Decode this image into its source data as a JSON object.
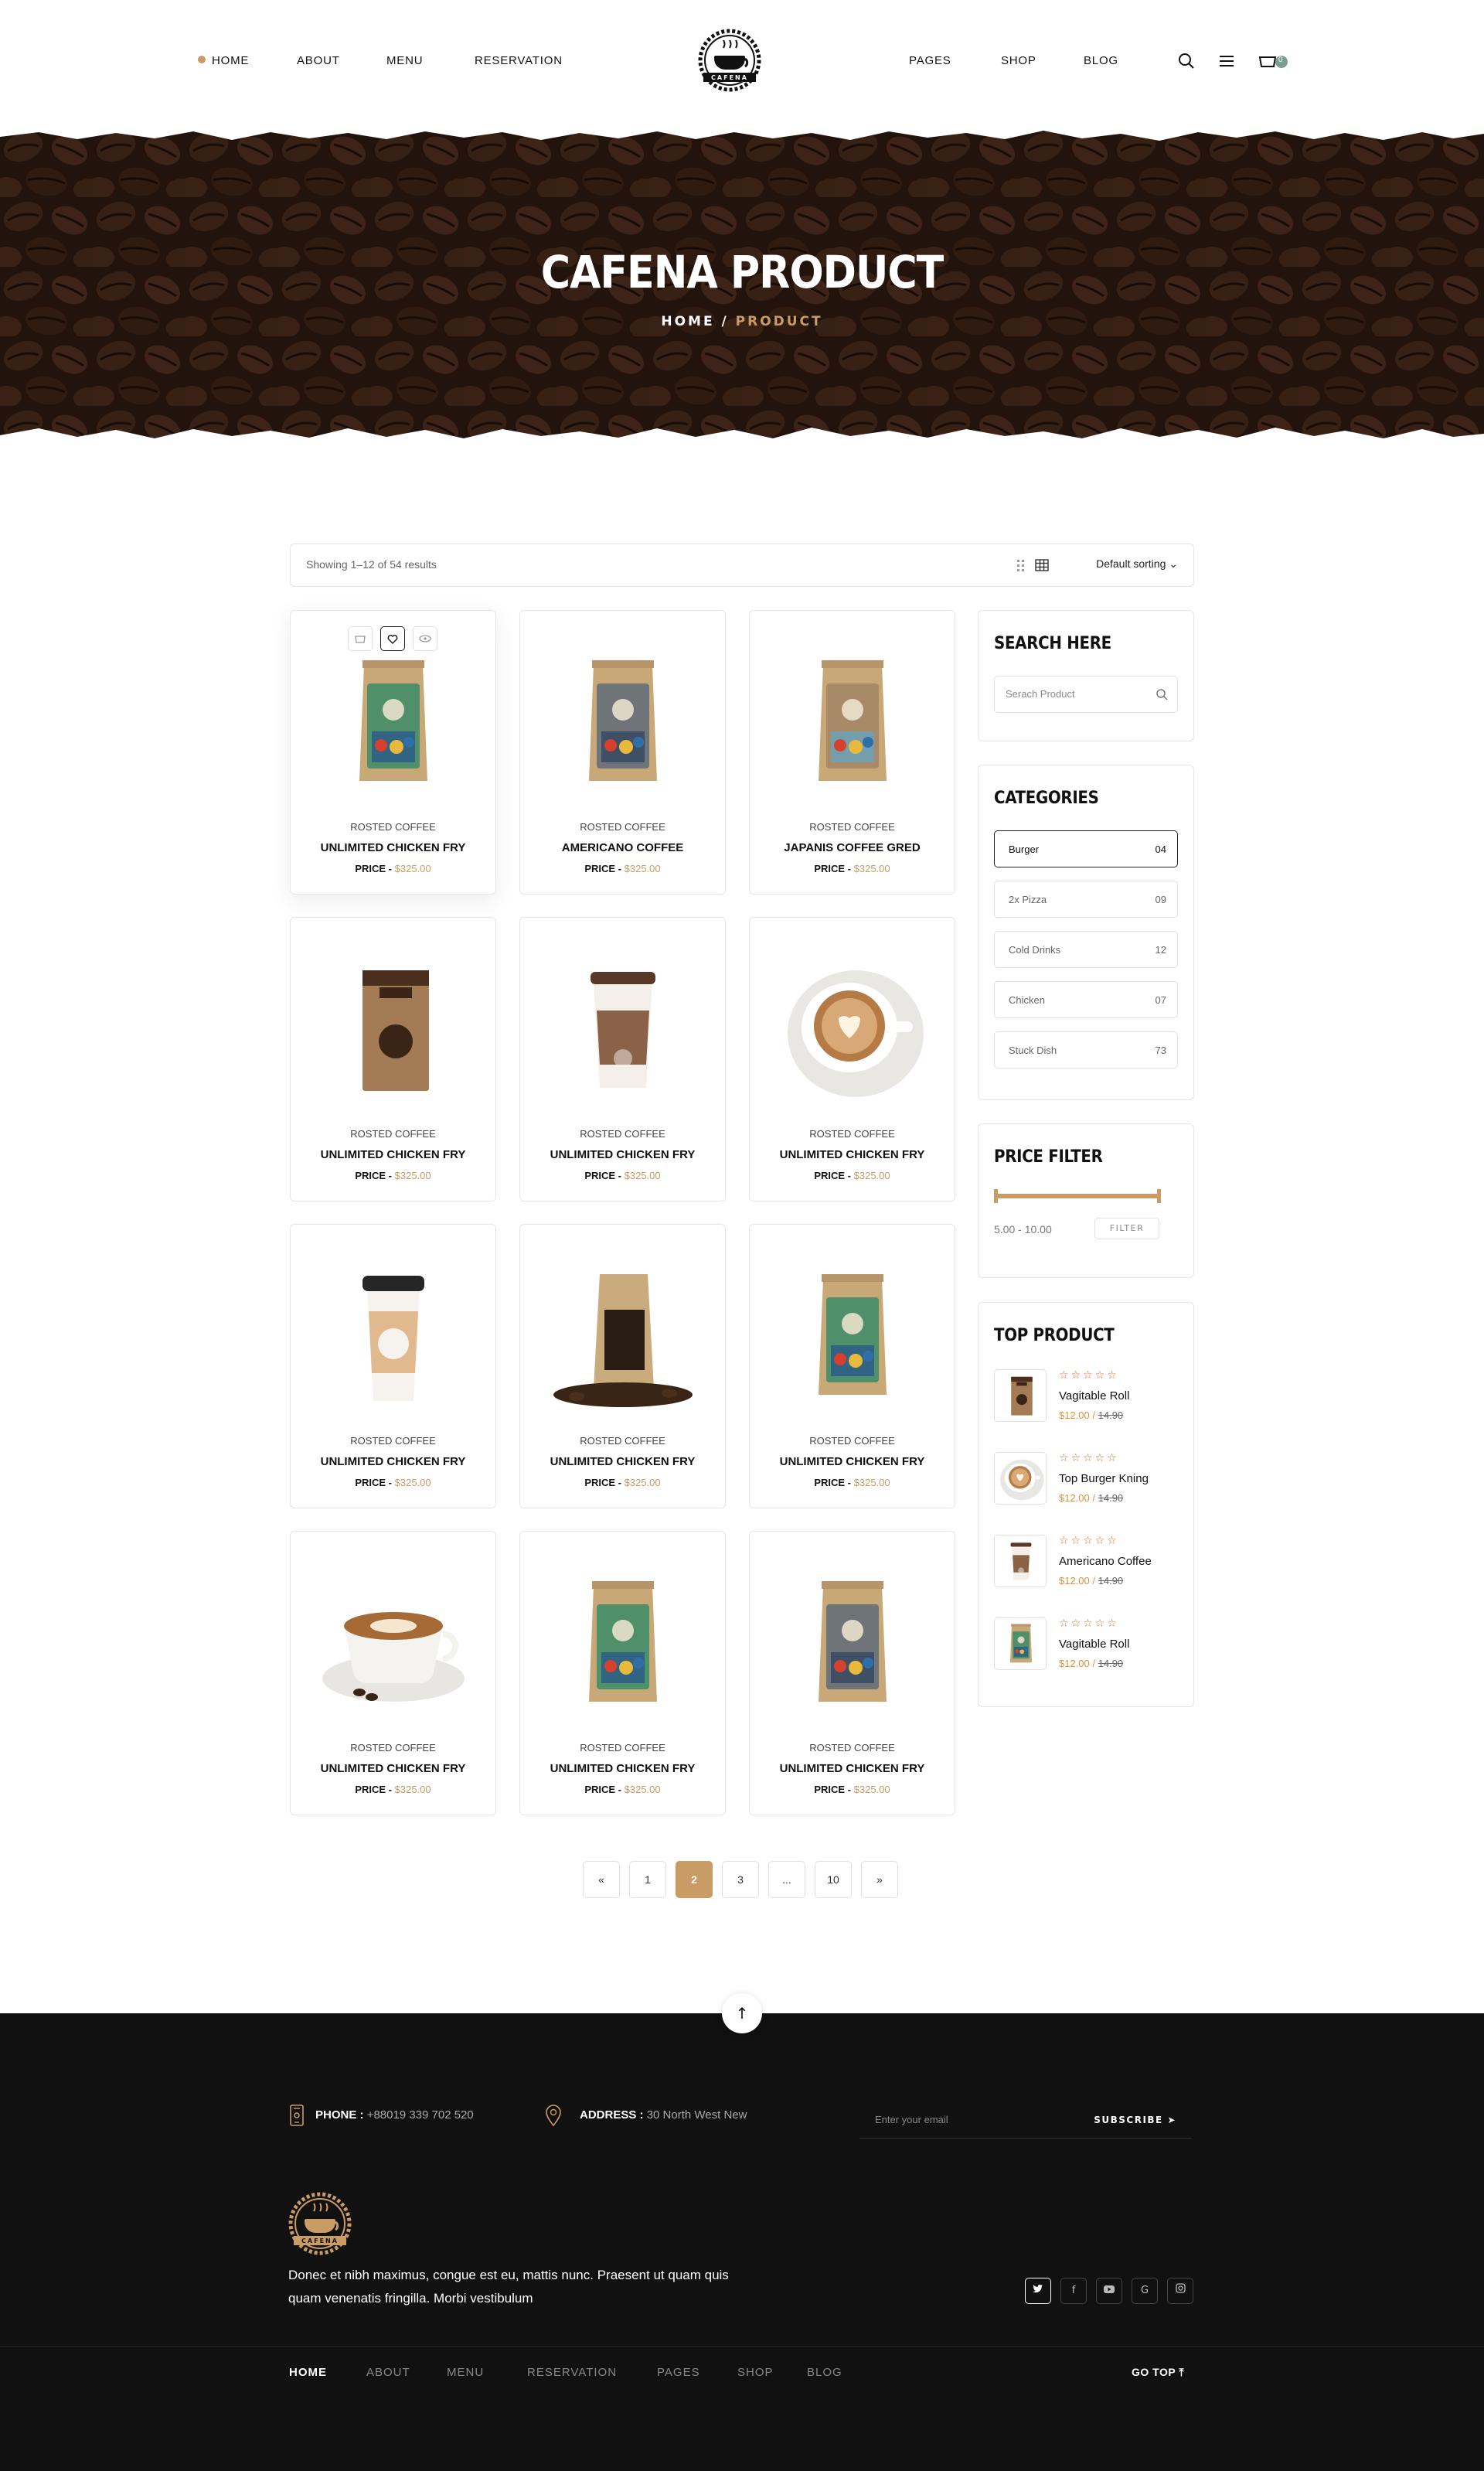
{
  "header": {
    "nav_left": [
      "HOME",
      "ABOUT",
      "MENU",
      "RESERVATION"
    ],
    "nav_right": [
      "PAGES",
      "SHOP",
      "BLOG"
    ],
    "logo_text": "CAFENA",
    "cart_count": "0",
    "icons": [
      "search-icon",
      "menu-icon",
      "cart-icon"
    ]
  },
  "hero": {
    "title": "CAFENA PRODUCT",
    "crumb_home": "HOME",
    "crumb_sep": "/",
    "crumb_active": "PRODUCT"
  },
  "toolbar": {
    "results": "Showing 1–12 of 54 results",
    "sort": "Default sorting"
  },
  "products": [
    {
      "category": "ROSTED COFFEE",
      "name": "UNLIMITED CHICKEN FRY",
      "price_label": "PRICE -",
      "price": "$325.00",
      "image": "green-bag"
    },
    {
      "category": "ROSTED COFFEE",
      "name": "AMERICANO COFFEE",
      "price_label": "PRICE -",
      "price": "$325.00",
      "image": "grey-bag"
    },
    {
      "category": "ROSTED COFFEE",
      "name": "JAPANIS COFFEE GRED",
      "price_label": "PRICE -",
      "price": "$325.00",
      "image": "peru-bag"
    },
    {
      "category": "ROSTED COFFEE",
      "name": "UNLIMITED CHICKEN FRY",
      "price_label": "PRICE -",
      "price": "$325.00",
      "image": "kraft-bag"
    },
    {
      "category": "ROSTED COFFEE",
      "name": "UNLIMITED CHICKEN FRY",
      "price_label": "PRICE -",
      "price": "$325.00",
      "image": "paper-cup"
    },
    {
      "category": "ROSTED COFFEE",
      "name": "UNLIMITED CHICKEN FRY",
      "price_label": "PRICE -",
      "price": "$325.00",
      "image": "latte-top"
    },
    {
      "category": "ROSTED COFFEE",
      "name": "UNLIMITED CHICKEN FRY",
      "price_label": "PRICE -",
      "price": "$325.00",
      "image": "togo-cup"
    },
    {
      "category": "ROSTED COFFEE",
      "name": "UNLIMITED CHICKEN FRY",
      "price_label": "PRICE -",
      "price": "$325.00",
      "image": "beans-bag"
    },
    {
      "category": "ROSTED COFFEE",
      "name": "UNLIMITED CHICKEN FRY",
      "price_label": "PRICE -",
      "price": "$325.00",
      "image": "green-bag"
    },
    {
      "category": "ROSTED COFFEE",
      "name": "UNLIMITED CHICKEN FRY",
      "price_label": "PRICE -",
      "price": "$325.00",
      "image": "latte-cup"
    },
    {
      "category": "ROSTED COFFEE",
      "name": "UNLIMITED CHICKEN FRY",
      "price_label": "PRICE -",
      "price": "$325.00",
      "image": "green-bag"
    },
    {
      "category": "ROSTED COFFEE",
      "name": "UNLIMITED CHICKEN FRY",
      "price_label": "PRICE -",
      "price": "$325.00",
      "image": "grey-bag"
    }
  ],
  "sidebar": {
    "search_title": "SEARCH HERE",
    "search_placeholder": "Serach Product",
    "categories_title": "CATEGORIES",
    "categories": [
      {
        "label": "Burger",
        "count": "04"
      },
      {
        "label": "2x Pizza",
        "count": "09"
      },
      {
        "label": "Cold Drinks",
        "count": "12"
      },
      {
        "label": "Chicken",
        "count": "07"
      },
      {
        "label": "Stuck Dish",
        "count": "73"
      }
    ],
    "price_title": "PRICE FILTER",
    "price_range": "5.00 - 10.00",
    "filter_label": "FILTER",
    "top_title": "TOP PRODUCT",
    "top_products": [
      {
        "stars": "☆☆☆☆☆",
        "name": "Vagitable Roll",
        "price": "$12.00 /",
        "old": "14.90",
        "image": "kraft-bag"
      },
      {
        "stars": "☆☆☆☆☆",
        "name": "Top Burger Kning",
        "price": "$12.00 /",
        "old": "14.90",
        "image": "latte-top"
      },
      {
        "stars": "☆☆☆☆☆",
        "name": "Americano Coffee",
        "price": "$12.00 /",
        "old": "14.90",
        "image": "paper-cup"
      },
      {
        "stars": "☆☆☆☆☆",
        "name": "Vagitable Roll",
        "price": "$12.00 /",
        "old": "14.90",
        "image": "green-bag"
      }
    ]
  },
  "pagination": [
    "«",
    "1",
    "2",
    "3",
    "...",
    "10",
    "»"
  ],
  "pagination_active": "2",
  "footer": {
    "to_top": "↑",
    "phone_label": "PHONE :",
    "phone": "+88019 339 702 520",
    "address_label": "ADDRESS :",
    "address": "30 North West New",
    "email_placeholder": "Enter your email",
    "subscribe": "SUBSCRIBE",
    "logo_text": "CAFENA",
    "text": "Donec et nibh maximus, congue est eu, mattis nunc. Praesent ut quam quis quam venenatis fringilla. Morbi vestibulum",
    "social": [
      "twitter-icon",
      "facebook-icon",
      "youtube-icon",
      "google-icon",
      "instagram-icon"
    ],
    "nav": [
      "HOME",
      "ABOUT",
      "MENU",
      "RESERVATION",
      "PAGES",
      "SHOP",
      "BLOG"
    ],
    "go_top": "GO TOP ⤒"
  },
  "colors": {
    "accent": "#c99b65",
    "dark": "#111111",
    "star": "#e26d2a"
  }
}
